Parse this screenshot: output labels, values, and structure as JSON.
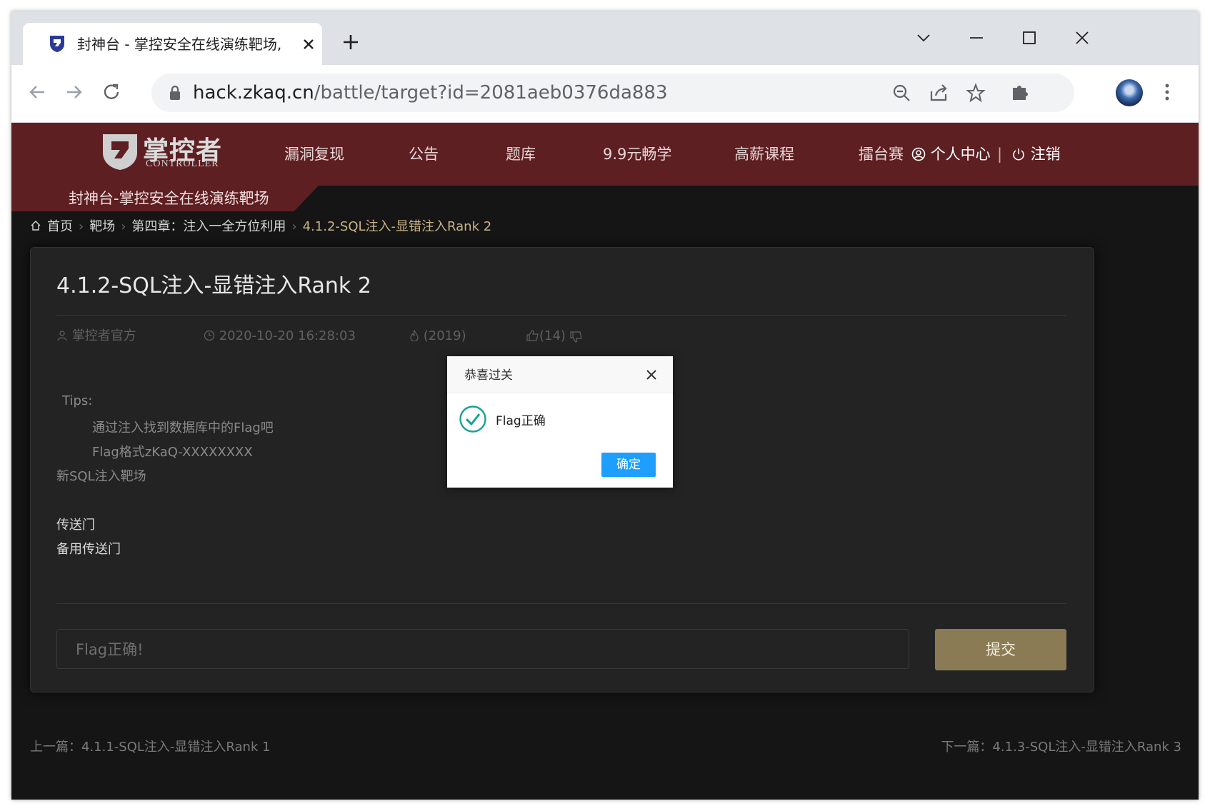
{
  "browser": {
    "tab_title": "封神台 - 掌控安全在线演练靶场,",
    "url_host": "hack.zkaq.cn",
    "url_path": "/battle/target?id=2081aeb0376da883"
  },
  "site": {
    "logo_text": "掌控者",
    "logo_sub": "CONTROLLER",
    "banner_text": "封神台-掌控安全在线演练靶场",
    "nav": [
      "漏洞复现",
      "公告",
      "题库",
      "9.9元畅学",
      "高薪课程",
      "擂台赛"
    ],
    "user_center": "个人中心",
    "logout": "注销"
  },
  "breadcrumb": {
    "home": "首页",
    "arena": "靶场",
    "chapter": "第四章：注入一全方位利用",
    "current": "4.1.2-SQL注入-显错注入Rank 2"
  },
  "card": {
    "title": "4.1.2-SQL注入-显错注入Rank 2",
    "author": "掌控者官方",
    "datetime": "2020-10-20 16:28:03",
    "views": "(2019)",
    "likes": "(14)",
    "tips_label": "Tips:",
    "tip1": "通过注入找到数据库中的Flag吧",
    "tip2": "Flag格式zKaQ-XXXXXXXX",
    "note": "新SQL注入靶场",
    "link1": "传送门",
    "link2": "备用传送门",
    "flag_input_value": "Flag正确!",
    "submit_label": "提交"
  },
  "pager": {
    "prev": "上一篇：4.1.1-SQL注入-显错注入Rank 1",
    "next": "下一篇：4.1.3-SQL注入-显错注入Rank 3"
  },
  "dialog": {
    "title": "恭喜过关",
    "message": "Flag正确",
    "ok_label": "确定"
  },
  "colors": {
    "nav_bg": "#5e1f22",
    "page_bg": "#151516",
    "card_bg": "#232324",
    "submit_bg": "#8a7b55",
    "breadcrumb_current": "#c9b386",
    "dialog_ok": "#1e9fff",
    "check_green": "#1aa094"
  },
  "icons": [
    "shield-favicon-icon",
    "close-icon",
    "plus-icon",
    "chevron-down-icon",
    "minimize-icon",
    "maximize-icon",
    "back-icon",
    "forward-icon",
    "reload-icon",
    "lock-icon",
    "zoom-icon",
    "share-icon",
    "star-icon",
    "extensions-icon",
    "more-icon",
    "home-icon",
    "user-icon",
    "clock-icon",
    "fire-icon",
    "thumb-up-icon",
    "thumb-down-icon",
    "power-icon",
    "check-circle-icon"
  ]
}
